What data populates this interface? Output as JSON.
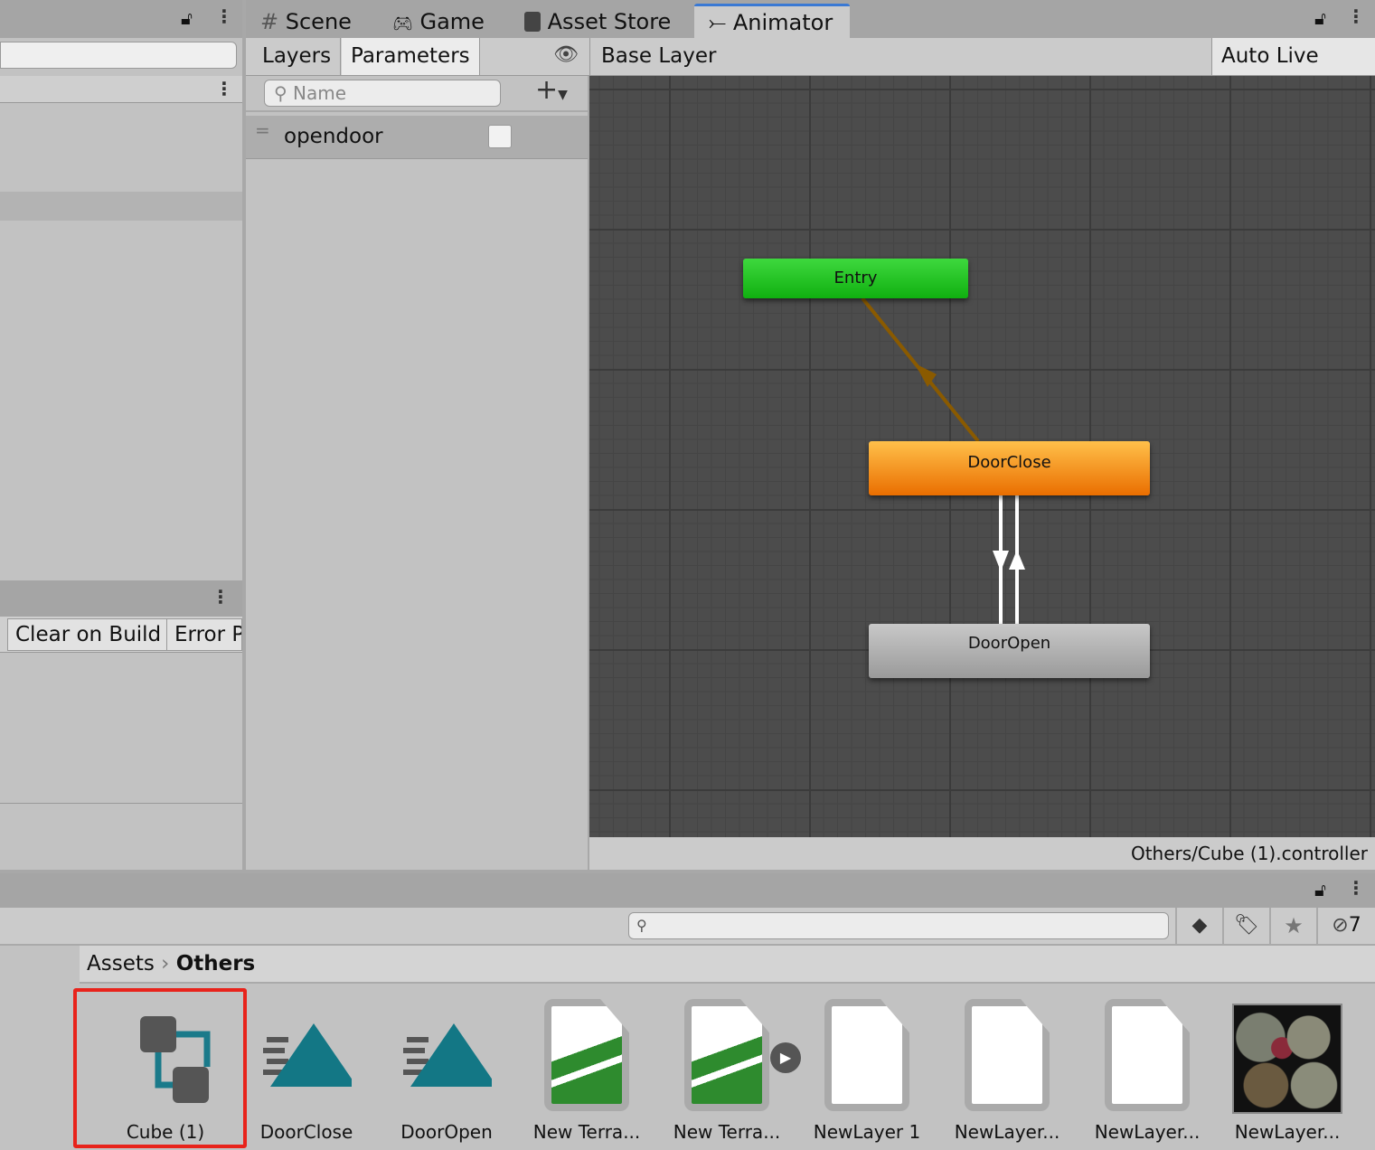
{
  "left_panel": {
    "console_buttons": [
      "Clear on Build",
      "Error P"
    ]
  },
  "tabs": [
    {
      "label": "Scene",
      "icon": "grid-icon"
    },
    {
      "label": "Game",
      "icon": "gamepad-icon"
    },
    {
      "label": "Asset Store",
      "icon": "bag-icon"
    },
    {
      "label": "Animator",
      "icon": "animator-icon",
      "active": true
    }
  ],
  "animator": {
    "subtabs": [
      "Layers",
      "Parameters"
    ],
    "breadcrumb": "Base Layer",
    "auto_live_link": "Auto Live Link",
    "search_placeholder": "Name",
    "parameters": [
      {
        "name": "opendoor",
        "type": "bool",
        "value": false
      }
    ],
    "states": {
      "entry": "Entry",
      "door_close": "DoorClose",
      "door_open": "DoorOpen"
    },
    "colors": {
      "entry": "#1fc01f",
      "default_state": "#f08a10",
      "state": "#b0b0b0",
      "transition": "#8a5a00"
    },
    "footer_path": "Others/Cube (1).controller"
  },
  "project": {
    "breadcrumb": [
      "Assets",
      "Others"
    ],
    "hidden_count": "7",
    "assets": [
      {
        "name": "Cube (1)",
        "type": "animator-controller",
        "selected": true
      },
      {
        "name": "DoorClose",
        "type": "animation-clip"
      },
      {
        "name": "DoorOpen",
        "type": "animation-clip"
      },
      {
        "name": "New Terra...",
        "type": "terrain"
      },
      {
        "name": "New Terra...",
        "type": "terrain"
      },
      {
        "name": "NewLayer 1",
        "type": "file"
      },
      {
        "name": "NewLayer...",
        "type": "file"
      },
      {
        "name": "NewLayer...",
        "type": "file"
      },
      {
        "name": "NewLayer...",
        "type": "texture"
      }
    ]
  }
}
